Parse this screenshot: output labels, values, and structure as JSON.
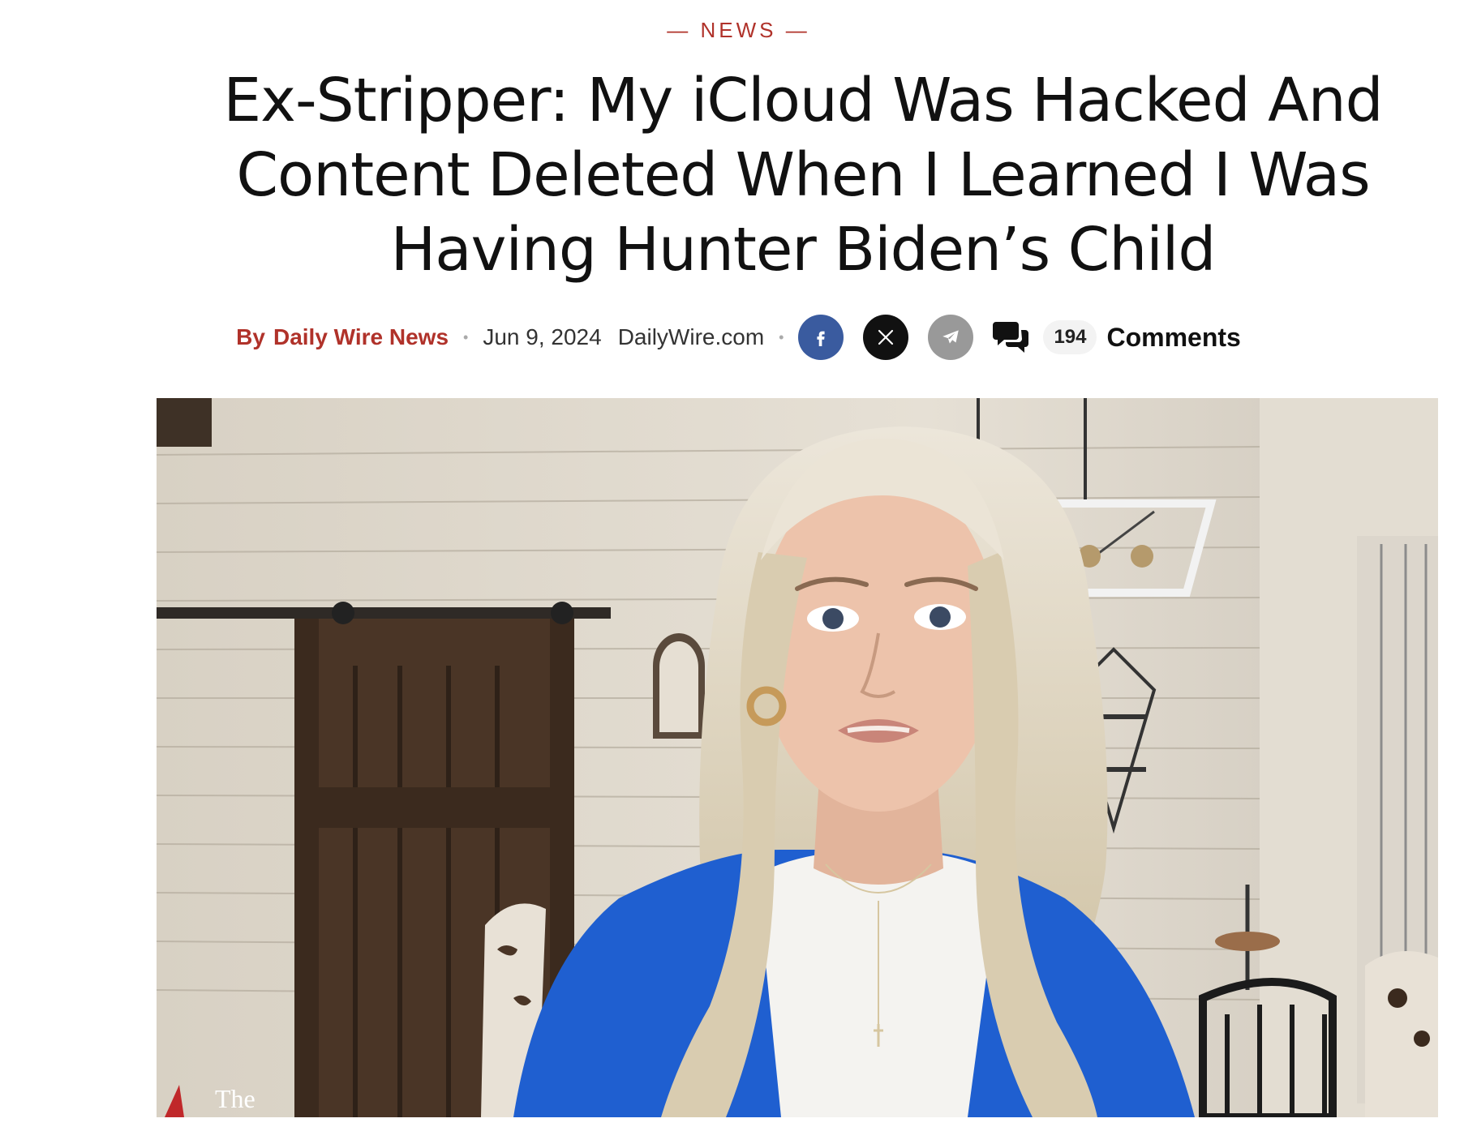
{
  "section": {
    "label": "NEWS",
    "dash": "—"
  },
  "article": {
    "headline": "Ex-Stripper: My iCloud Was Hacked And Content Deleted When I Learned I Was Having Hunter Biden’s Child"
  },
  "byline": {
    "by": "By",
    "author": "Daily Wire News",
    "separator": "•",
    "date": "Jun 9, 2024",
    "source": "DailyWire.com"
  },
  "share": {
    "facebook_icon": "facebook-icon",
    "x_icon": "x-icon",
    "telegram_icon": "telegram-icon"
  },
  "comments": {
    "icon": "comments-icon",
    "count": "194",
    "label": "Comments"
  },
  "hero": {
    "watermark": "The"
  },
  "colors": {
    "accent": "#b0322a",
    "facebook": "#3a5b9f",
    "x": "#111111",
    "telegram": "#999999"
  }
}
